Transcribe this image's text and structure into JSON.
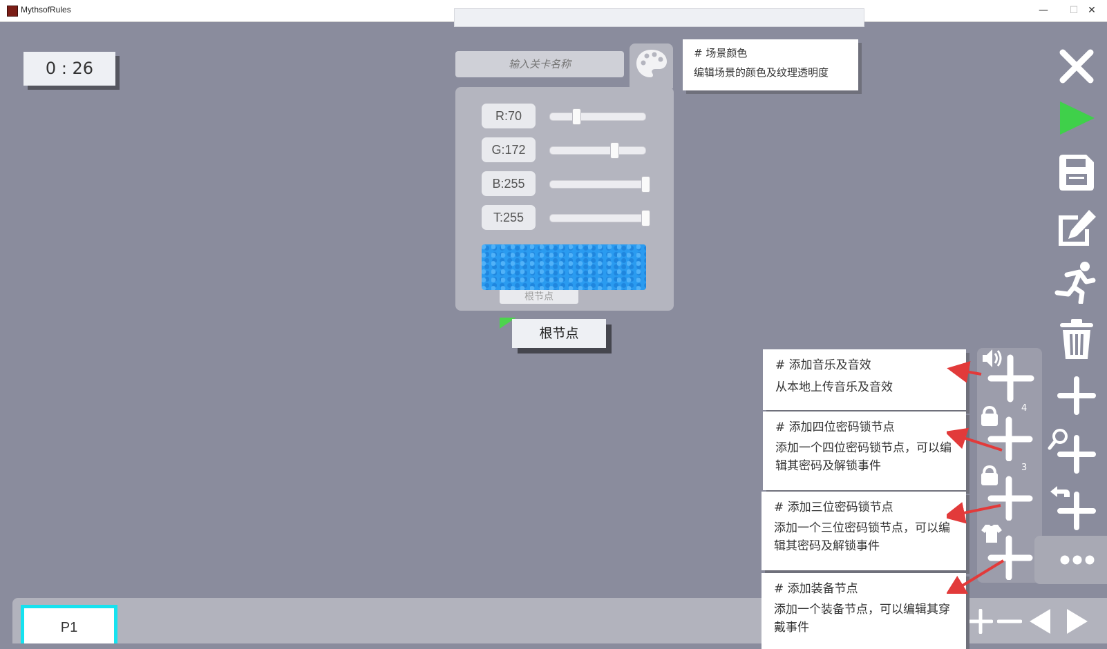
{
  "window": {
    "title": "MythsofRules",
    "minimize": "—",
    "maximize": "☐",
    "close": "✕"
  },
  "timer": {
    "value": "0 : 26"
  },
  "level_name": {
    "placeholder": "输入关卡名称",
    "value": ""
  },
  "scene_color": {
    "r_label": "R:70",
    "r": 70,
    "g_label": "G:172",
    "g": 172,
    "b_label": "B:255",
    "b": 255,
    "t_label": "T:255",
    "t": 255,
    "preview_color": "#2a9bf0",
    "hidden_node_label": "根节点"
  },
  "tooltips": {
    "scene_color": {
      "title": "# 场景颜色",
      "desc": "编辑场景的颜色及纹理透明度"
    },
    "add_audio": {
      "title": "# 添加音乐及音效",
      "desc": "从本地上传音乐及音效"
    },
    "add_lock4": {
      "title": "# 添加四位密码锁节点",
      "desc": "添加一个四位密码锁节点，可以编辑其密码及解锁事件"
    },
    "add_lock3": {
      "title": "# 添加三位密码锁节点",
      "desc": "添加一个三位密码锁节点，可以编辑其密码及解锁事件"
    },
    "add_equip": {
      "title": "# 添加装备节点",
      "desc": "添加一个装备节点，可以编辑其穿戴事件"
    }
  },
  "root_node": {
    "label": "根节点"
  },
  "add_panel": {
    "lock4_badge": "4",
    "lock3_badge": "3"
  },
  "pages": {
    "current": "P1"
  },
  "colors": {
    "accent_green": "#3fd04a",
    "tab_border": "#16e2ef",
    "arrow_red": "#e23a3a"
  }
}
